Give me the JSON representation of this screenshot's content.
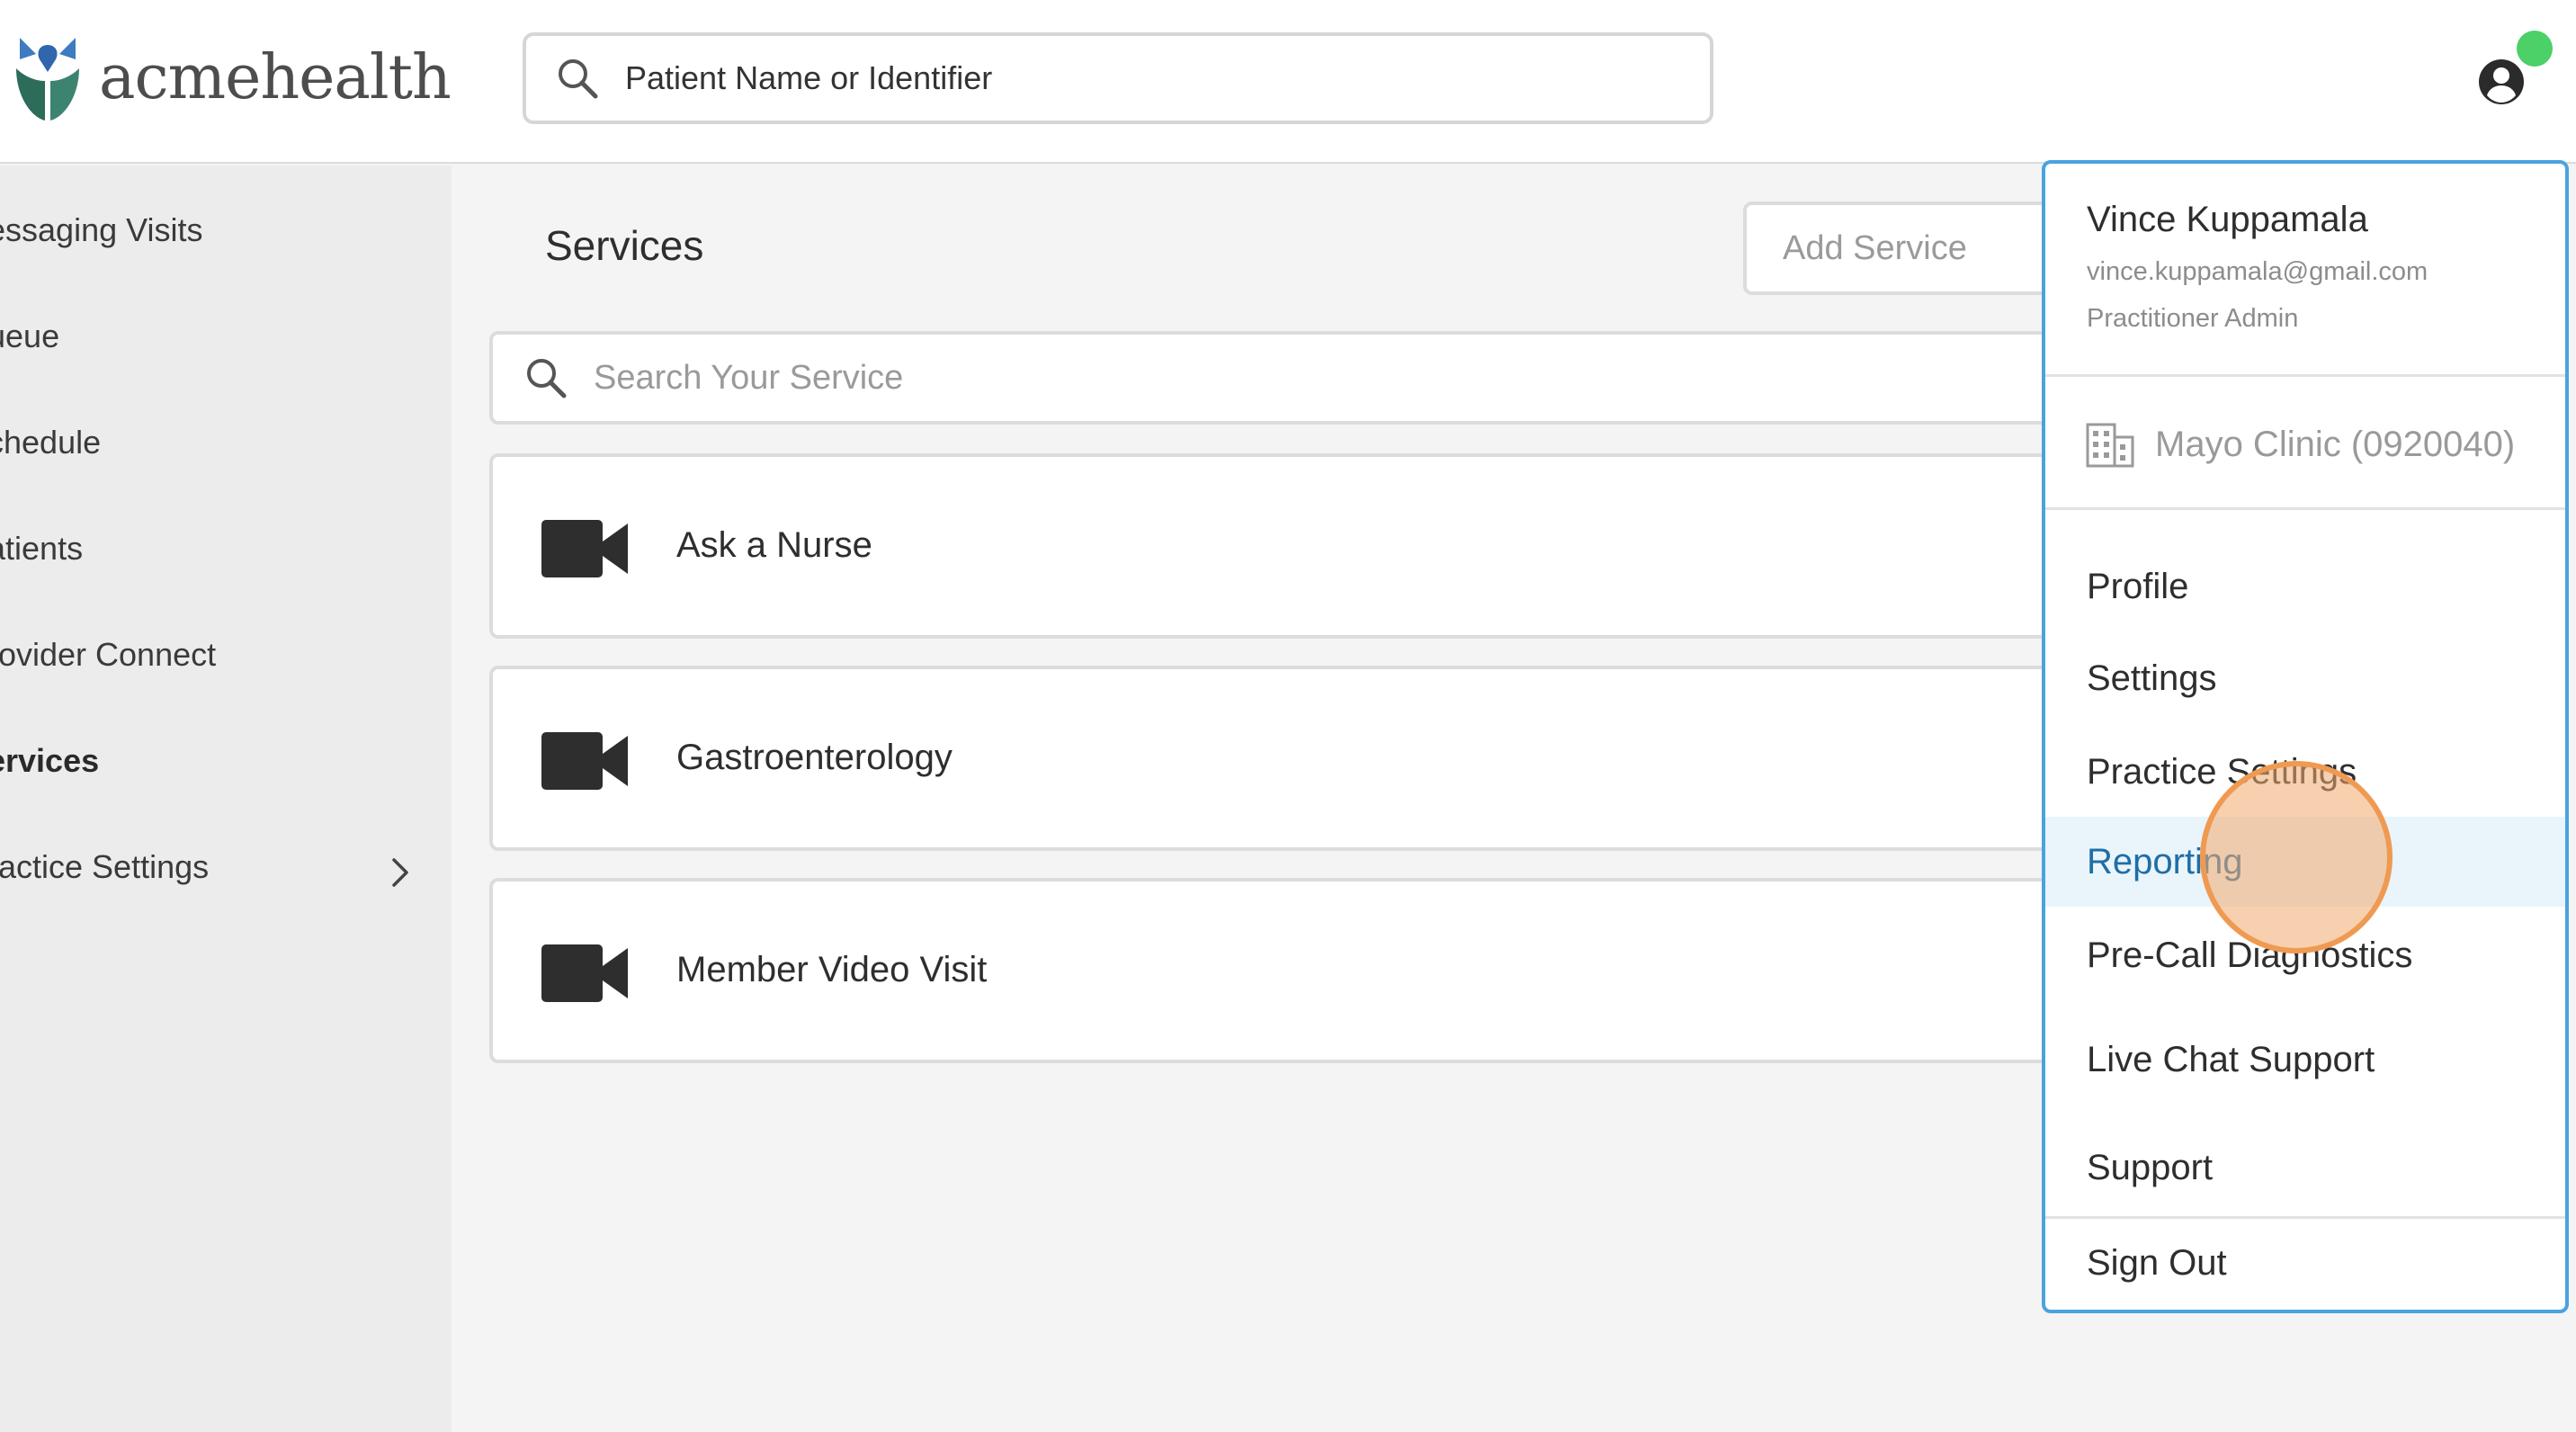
{
  "header": {
    "logo_text": "acmehealth",
    "search": {
      "placeholder": "Patient Name or Identifier",
      "value": ""
    },
    "status_color": "#4cd068"
  },
  "sidebar": {
    "items": [
      {
        "label": "essaging Visits"
      },
      {
        "label": "ueue"
      },
      {
        "label": "chedule"
      },
      {
        "label": "atients"
      },
      {
        "label": "rovider Connect"
      },
      {
        "label": "ervices",
        "active": true
      },
      {
        "label": "ractice Settings",
        "has_submenu": true
      }
    ]
  },
  "main": {
    "title": "Services",
    "add_button": "Add Service",
    "search": {
      "placeholder": "Search Your Service",
      "value": ""
    },
    "services": [
      {
        "name": "Ask a Nurse",
        "icon": "video-camera-icon"
      },
      {
        "name": "Gastroenterology",
        "icon": "video-camera-icon"
      },
      {
        "name": "Member Video Visit",
        "icon": "video-camera-icon"
      }
    ]
  },
  "user_menu": {
    "name": "Vince Kuppamala",
    "email": "vince.kuppamala@gmail.com",
    "role": "Practitioner Admin",
    "clinic": "Mayo Clinic (0920040)",
    "items": [
      {
        "label": "Profile"
      },
      {
        "label": "Settings"
      },
      {
        "label": "Practice Settings"
      },
      {
        "label": "Reporting",
        "highlighted": true
      },
      {
        "label": "Pre-Call Diagnostics"
      },
      {
        "label": "Live Chat Support"
      },
      {
        "label": "Support"
      },
      {
        "label": "Sign Out"
      }
    ]
  },
  "colors": {
    "accent_border": "#4aa3e0",
    "highlight_text": "#1f6ea6",
    "highlight_bg": "#eaf4fb",
    "click_indicator": "#ef9a52"
  }
}
